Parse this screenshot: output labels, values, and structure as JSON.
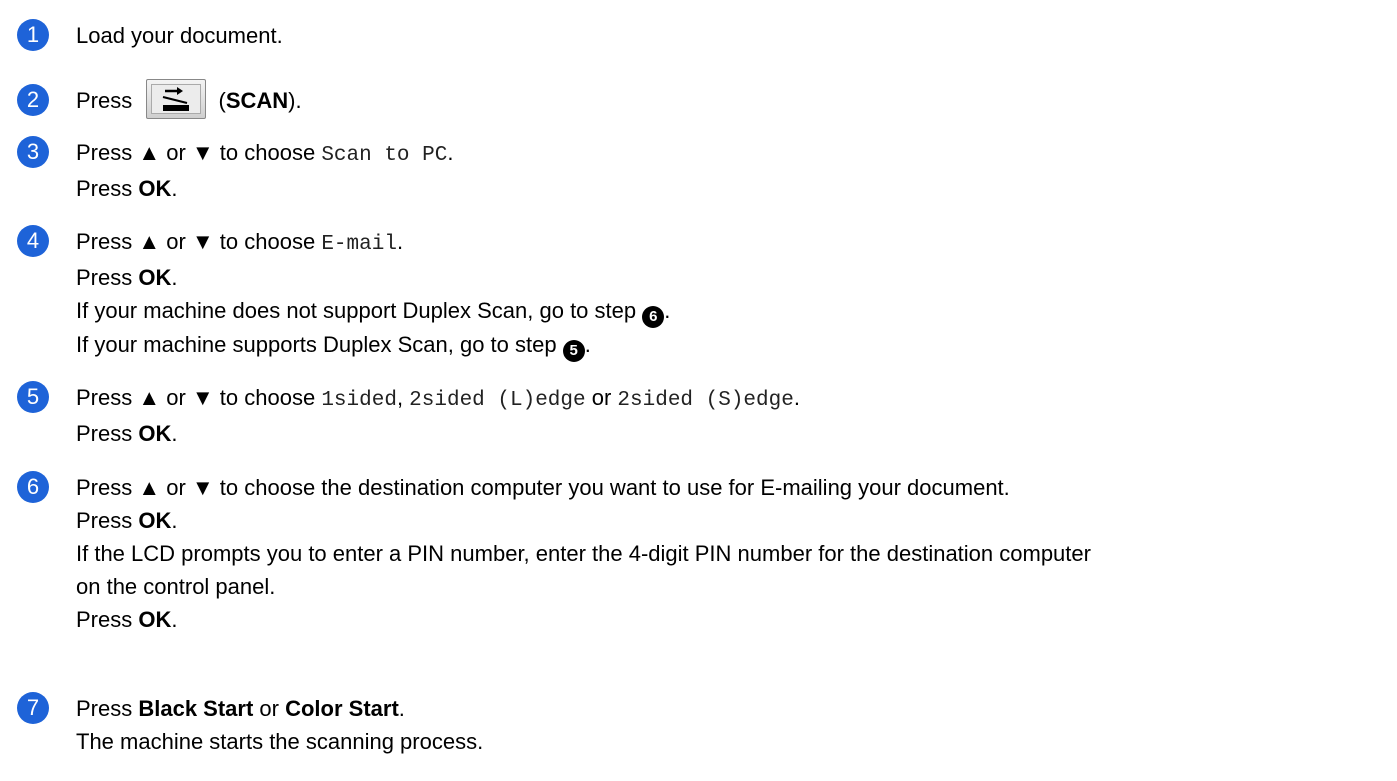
{
  "steps": [
    {
      "num": "1",
      "line1": "Load your document."
    },
    {
      "num": "2",
      "press": "Press",
      "open": "(",
      "scan": "SCAN",
      "close": ")."
    },
    {
      "num": "3",
      "pre": "Press ▲ or ▼ to choose ",
      "option": "Scan to PC",
      "post": ".",
      "press": "Press ",
      "ok": "OK",
      "dot": "."
    },
    {
      "num": "4",
      "pre": "Press ▲ or ▼ to choose ",
      "option": "E-mail",
      "post": ".",
      "press": "Press ",
      "ok": "OK",
      "dot": ".",
      "line3a": "If your machine does not support Duplex Scan, go to step ",
      "ref3": "6",
      "line3b": ".",
      "line4a": "If your machine supports Duplex Scan, go to step ",
      "ref4": "5",
      "line4b": "."
    },
    {
      "num": "5",
      "pre": "Press ▲ or ▼ to choose ",
      "opt1": "1sided",
      "comma": ", ",
      "opt2": "2sided (L)edge",
      "or": " or ",
      "opt3": "2sided (S)edge",
      "post": ".",
      "press": "Press ",
      "ok": "OK",
      "dot": "."
    },
    {
      "num": "6",
      "line1": "Press ▲ or ▼ to choose the destination computer you want to use for E-mailing your document.",
      "press": "Press ",
      "ok": "OK",
      "dot": ".",
      "line3": "If the LCD prompts you to enter a PIN number, enter the 4-digit PIN number for the destination computer",
      "line4": "on the control panel.",
      "press2": "Press ",
      "ok2": "OK",
      "dot2": "."
    },
    {
      "num": "7",
      "press": "Press ",
      "black": "Black Start",
      "or": " or ",
      "color": "Color Start",
      "dot": ".",
      "line2": "The machine starts the scanning process."
    }
  ],
  "colors": {
    "badge": "#1e63d8"
  },
  "icons": {
    "scan_button": "scan-key-icon"
  }
}
